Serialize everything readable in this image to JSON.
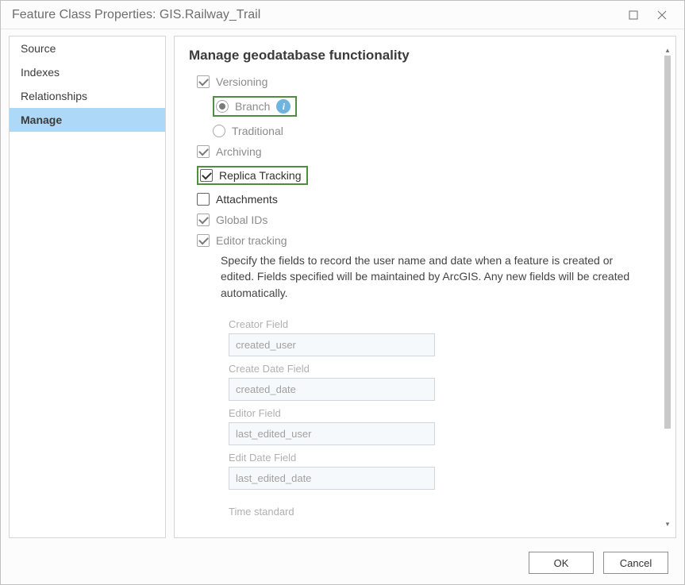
{
  "window": {
    "title": "Feature Class Properties: GIS.Railway_Trail"
  },
  "sidebar": {
    "items": [
      {
        "label": "Source",
        "active": false
      },
      {
        "label": "Indexes",
        "active": false
      },
      {
        "label": "Relationships",
        "active": false
      },
      {
        "label": "Manage",
        "active": true
      }
    ]
  },
  "main": {
    "heading": "Manage geodatabase functionality",
    "versioning": {
      "label": "Versioning",
      "branch": {
        "label": "Branch"
      },
      "traditional": {
        "label": "Traditional"
      }
    },
    "archiving": {
      "label": "Archiving"
    },
    "replica_tracking": {
      "label": "Replica Tracking"
    },
    "attachments": {
      "label": "Attachments"
    },
    "global_ids": {
      "label": "Global IDs"
    },
    "editor_tracking": {
      "label": "Editor tracking",
      "description": "Specify the fields to record the user name and date when a feature is created or edited. Fields specified will be maintained by ArcGIS. Any new fields will be created automatically.",
      "creator_field": {
        "label": "Creator Field",
        "value": "created_user"
      },
      "create_date_field": {
        "label": "Create Date Field",
        "value": "created_date"
      },
      "editor_field": {
        "label": "Editor Field",
        "value": "last_edited_user"
      },
      "edit_date_field": {
        "label": "Edit Date Field",
        "value": "last_edited_date"
      },
      "time_standard": {
        "label": "Time standard"
      }
    }
  },
  "footer": {
    "ok": "OK",
    "cancel": "Cancel"
  }
}
